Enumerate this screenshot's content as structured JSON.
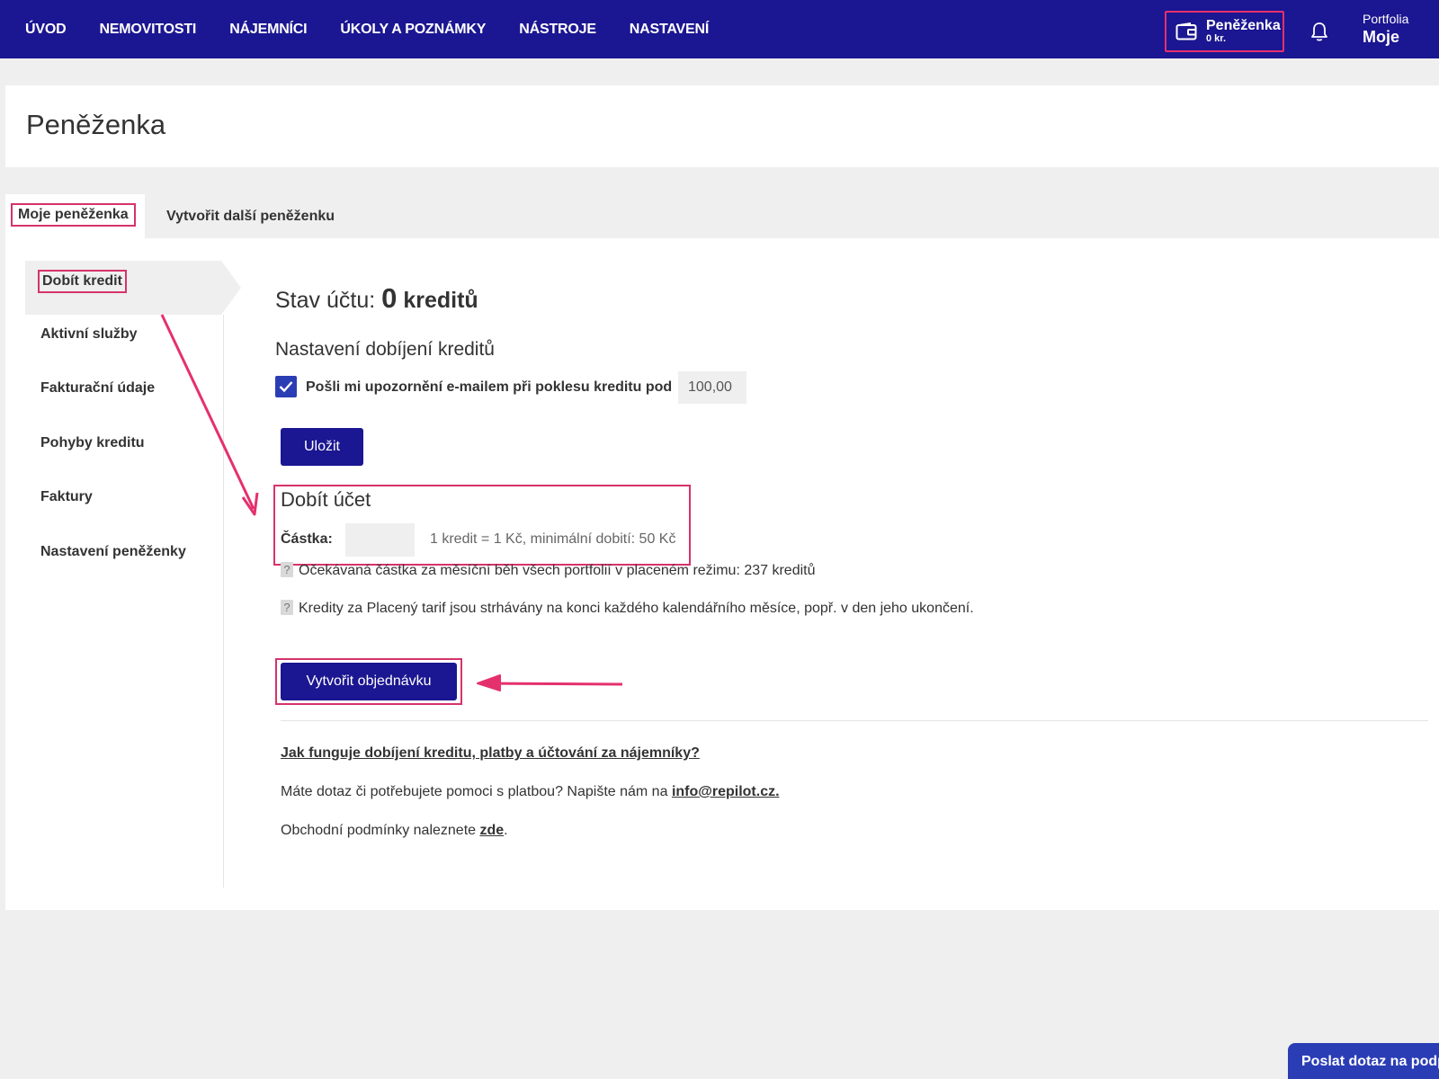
{
  "nav": {
    "items": [
      "ÚVOD",
      "NEMOVITOSTI",
      "NÁJEMNÍCI",
      "ÚKOLY A POZNÁMKY",
      "NÁSTROJE",
      "NASTAVENÍ"
    ],
    "wallet_title": "Peněženka",
    "wallet_amount": "0 kr.",
    "portfolio_label": "Portfolia",
    "portfolio_value": "Moje"
  },
  "page": {
    "title": "Peněženka"
  },
  "tabs": {
    "active": "Moje peněženka",
    "other": "Vytvořit další peněženku"
  },
  "sidebar": {
    "items": [
      "Dobít kredit",
      "Aktivní služby",
      "Fakturační údaje",
      "Pohyby kreditu",
      "Faktury",
      "Nastavení peněženky"
    ]
  },
  "content": {
    "balance_prefix": "Stav účtu:",
    "balance_value": "0",
    "balance_unit": "kreditů",
    "settings_heading": "Nastavení dobíjení kreditů",
    "email_alert_label": "Pošli mi upozornění e-mailem při poklesu kreditu pod",
    "threshold_value": "100,00",
    "save_label": "Uložit",
    "topup_heading": "Dobít účet",
    "amount_label": "Částka:",
    "amount_value": "",
    "amount_hint": "1 kredit = 1 Kč, minimální dobití: 50 Kč",
    "info_1": "Očekávaná částka za měsíční běh všech portfolií v placeném režimu: 237 kreditů",
    "info_2": "Kredity za Placený tarif jsou strhávány na konci každého kalendářního měsíce, popř. v den jeho ukončení.",
    "info_icon": "?",
    "order_label": "Vytvořit objednávku",
    "faq_link": "Jak funguje dobíjení kreditu, platby a účtování za nájemníky?",
    "contact_text": "Máte dotaz či potřebujete pomoci s platbou? Napište nám na",
    "contact_email": "info@repilot.cz.",
    "terms_text": "Obchodní podmínky naleznete",
    "terms_link": "zde",
    "terms_end": "."
  },
  "help_button": "Poslat dotaz na podporu",
  "colors": {
    "primary": "#1b1691",
    "accent": "#d6336c",
    "checkbox": "#2b3db5"
  }
}
